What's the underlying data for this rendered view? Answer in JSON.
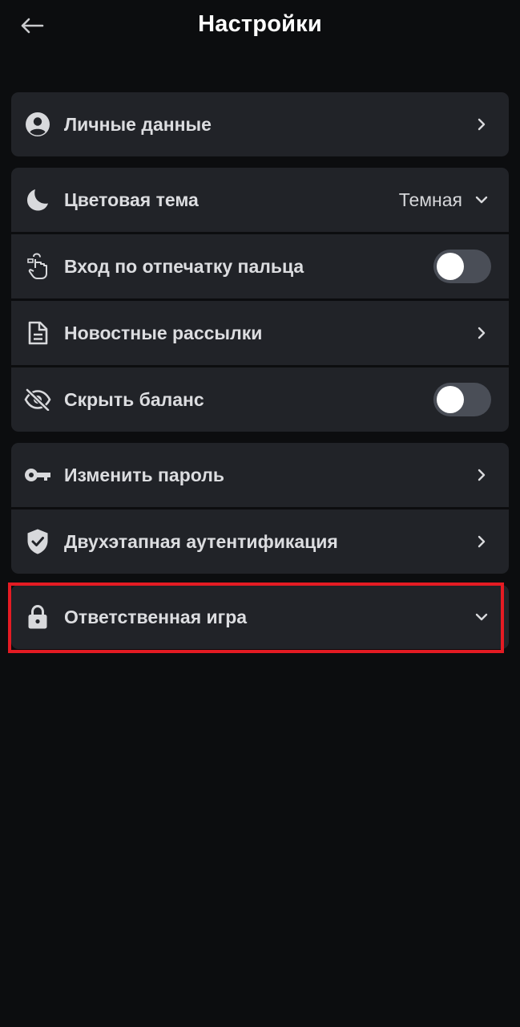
{
  "header": {
    "title": "Настройки",
    "back_icon": "arrow-left-icon"
  },
  "sections": [
    {
      "items": [
        {
          "label": "Личные данные",
          "icon": "account-circle-icon",
          "control": "chevron-right"
        }
      ]
    },
    {
      "items": [
        {
          "label": "Цветовая тема",
          "icon": "moon-icon",
          "control": "dropdown",
          "value": "Темная"
        },
        {
          "label": "Вход по отпечатку пальца",
          "icon": "fingerprint-touch-icon",
          "control": "toggle",
          "on": false
        },
        {
          "label": "Новостные рассылки",
          "icon": "document-icon",
          "control": "chevron-right"
        },
        {
          "label": "Скрыть баланс",
          "icon": "eye-off-icon",
          "control": "toggle",
          "on": false
        }
      ]
    },
    {
      "items": [
        {
          "label": "Изменить пароль",
          "icon": "key-icon",
          "control": "chevron-right"
        },
        {
          "label": "Двухэтапная аутентификация",
          "icon": "shield-check-icon",
          "control": "chevron-right"
        }
      ]
    },
    {
      "items": [
        {
          "label": "Ответственная игра",
          "icon": "lock-icon",
          "control": "chevron-down",
          "highlighted": true
        }
      ]
    }
  ],
  "colors": {
    "background": "#0c0d0f",
    "row_background": "#212328",
    "toggle_off": "#4a4e57",
    "highlight_border": "#e41b23"
  }
}
